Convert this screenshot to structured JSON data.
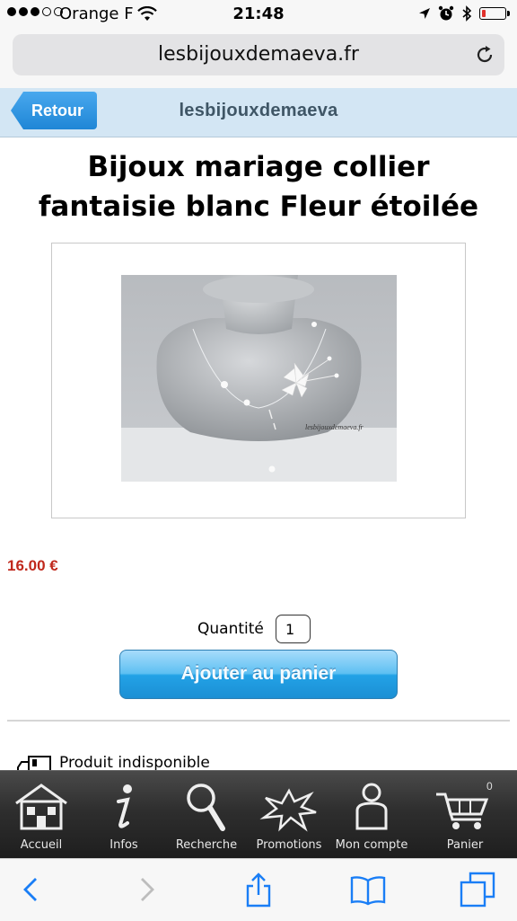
{
  "status_bar": {
    "carrier": "Orange F",
    "time": "21:48",
    "battery_level_percent": 15
  },
  "browser": {
    "url": "lesbijouxdemaeva.fr"
  },
  "header": {
    "back_label": "Retour",
    "site_name": "lesbijouxdemaeva"
  },
  "product": {
    "title_line1": "Bijoux mariage collier",
    "title_line2": "fantaisie blanc Fleur étoilée",
    "image_watermark": "lesbijouxdemaeva.fr",
    "price": "16.00 €",
    "quantity_label": "Quantité",
    "quantity_value": "1",
    "add_to_cart_label": "Ajouter au panier",
    "stock_status": "Produit indisponible"
  },
  "tab_bar": {
    "items": [
      {
        "label": "Accueil",
        "icon": "home-icon"
      },
      {
        "label": "Infos",
        "icon": "info-icon"
      },
      {
        "label": "Recherche",
        "icon": "magnifier-icon"
      },
      {
        "label": "Promotions",
        "icon": "starburst-icon"
      },
      {
        "label": "Mon compte",
        "icon": "user-icon"
      },
      {
        "label": "Panier",
        "icon": "cart-icon"
      }
    ],
    "cart_count": "0"
  },
  "safari_toolbar": {
    "buttons": [
      "back-icon",
      "forward-icon",
      "share-icon",
      "bookmarks-icon",
      "tabs-icon"
    ]
  },
  "colors": {
    "price": "#c0281c",
    "header_bg": "#d3e6f4",
    "button_blue": "#23a2e6"
  }
}
